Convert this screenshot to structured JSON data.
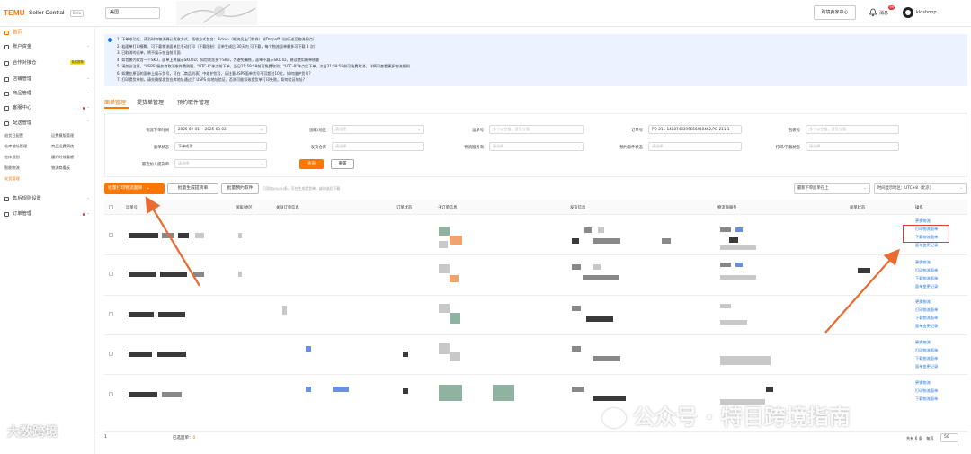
{
  "header": {
    "logo": "TEMU",
    "app_name": "Seller Central",
    "beta": "Beta",
    "region": "美国",
    "cross_border_button": "跨境卖家中心",
    "messages_label": "消息",
    "messages_count": "99",
    "username": "kloshopp"
  },
  "sidebar": {
    "items": [
      {
        "label": "首页"
      },
      {
        "label": "账户资金"
      },
      {
        "label": "合作对接仓",
        "badge": "免费推荐"
      },
      {
        "label": "店铺管理"
      },
      {
        "label": "商品管理"
      },
      {
        "label": "客服中心"
      },
      {
        "label": "配送管理"
      },
      {
        "label": "售后规则设置"
      },
      {
        "label": "订单管理"
      }
    ],
    "sub_items": [
      "退货日配置",
      "运费模版管理",
      "仓库地址管理",
      "商品运费预估",
      "仓库规划",
      "履约时效看板",
      "智能物流",
      "物流商看板",
      "发货管理"
    ]
  },
  "notice": {
    "lines": [
      "1. 下单成功后，请及时和物流确认揽收方式，揽收方式包含：Pickup（物流员上门取件）或Dropoff（自行送至物流网点）",
      "2. 若面单打印模糊、可下载物流面单后手动打印（下载限制：运单生成后 30天内 可下载，每个物流面单最多可下载 3 次）",
      "3. 已取消的运单，将不展示在当前页面",
      "4. 如包裹内仅含一个SKU，面单上将展示SKU ID；如包裹含多个SKU，为避免漏拣，面单不展示SKU ID，建议使用箱单核查",
      "5. 请务必注意，\"USPS\"服务商取消收件费则税，\"UTC-8\"休点前下单，当日21:59:59前可免费取消；\"UTC-8\"休点后下单，次日21:59:59前可免费取消，详情可查看更多物流细则",
      "6. 如需在原面的面单上展示货号，可在【商品列表】中维护货号，请注意USPS面单货号不可超过10位。如何维护货号?",
      "7. 打印提货单前，请先确保发货仓库地址通过了 USPS 的地址验证，否则可能导致提货单打印失败。如何验证地址?"
    ]
  },
  "tabs": [
    "面单管理",
    "提货单管理",
    "预约取件管理"
  ],
  "filters": {
    "create_time_label": "物流下单时间",
    "create_time_value": "2025-02-01 ~ 2025-03-03",
    "country_label": "国家/地区",
    "country_placeholder": "请选择",
    "tracking_label": "运单号",
    "tracking_placeholder": "多个以空格、逗号分隔",
    "order_label": "订单号",
    "order_value": "PO-211-1488748399656460462,PO-211-1",
    "package_label": "包裹号",
    "package_placeholder": "多个以空格、逗号分隔",
    "sheet_status_label": "面单状态",
    "sheet_status_value": "下单成功",
    "ship_warehouse_label": "发货仓库",
    "ship_warehouse_placeholder": "请选择",
    "carrier_label": "物流服务商",
    "carrier_placeholder": "请选择",
    "pickup_status_label": "预约取件状态",
    "pickup_status_placeholder": "请选择",
    "print_status_label": "打印/下载状态",
    "print_status_placeholder": "请选择",
    "recent_add_label": "最近加入提货单",
    "recent_add_placeholder": "请选择",
    "query_button": "查询",
    "reset_button": "重置"
  },
  "actions": {
    "batch_print": "批量打印物流面单",
    "batch_pickup_sheet": "批量生成提货单",
    "batch_pickup": "批量预约取件",
    "hint": "已添加(0)/(0)条，可在生成提货单，或勾选后下载",
    "sort": "最新下单面单在上",
    "timezone": "时间显示时区：UTC+8（北京）"
  },
  "table": {
    "headers": [
      "运单号",
      "国家/地区",
      "关联订单信息",
      "订单状态",
      "子订单信息",
      "发货信息",
      "物流商服务",
      "面单状态",
      "操作"
    ],
    "row_ops": [
      [
        "更换物流",
        "打印物流面单",
        "下载物流面单",
        "面单变更记录"
      ],
      [
        "更换物流",
        "打印物流面单",
        "下载物流面单",
        "面单变更记录"
      ],
      [
        "更换物流",
        "打印物流面单",
        "下载物流面单",
        "面单变更记录"
      ],
      [
        "更换物流",
        "打印物流面单",
        "下载物流面单",
        "面单变更记录"
      ],
      [
        "更换物流",
        "打印物流面单",
        "下载物流面单"
      ]
    ]
  },
  "footer": {
    "selected_label": "已选面单：",
    "selected_count": "0",
    "total": "共有 6 条",
    "page": "1",
    "per_page_label": "每页",
    "page_size": "50"
  },
  "watermarks": {
    "left": "大数跨境",
    "right": "公众号 · 特目跨境指南"
  },
  "colors": {
    "brand_orange": "#fb7701",
    "link_blue": "#1a73e8",
    "annotation_red": "#e53935"
  }
}
